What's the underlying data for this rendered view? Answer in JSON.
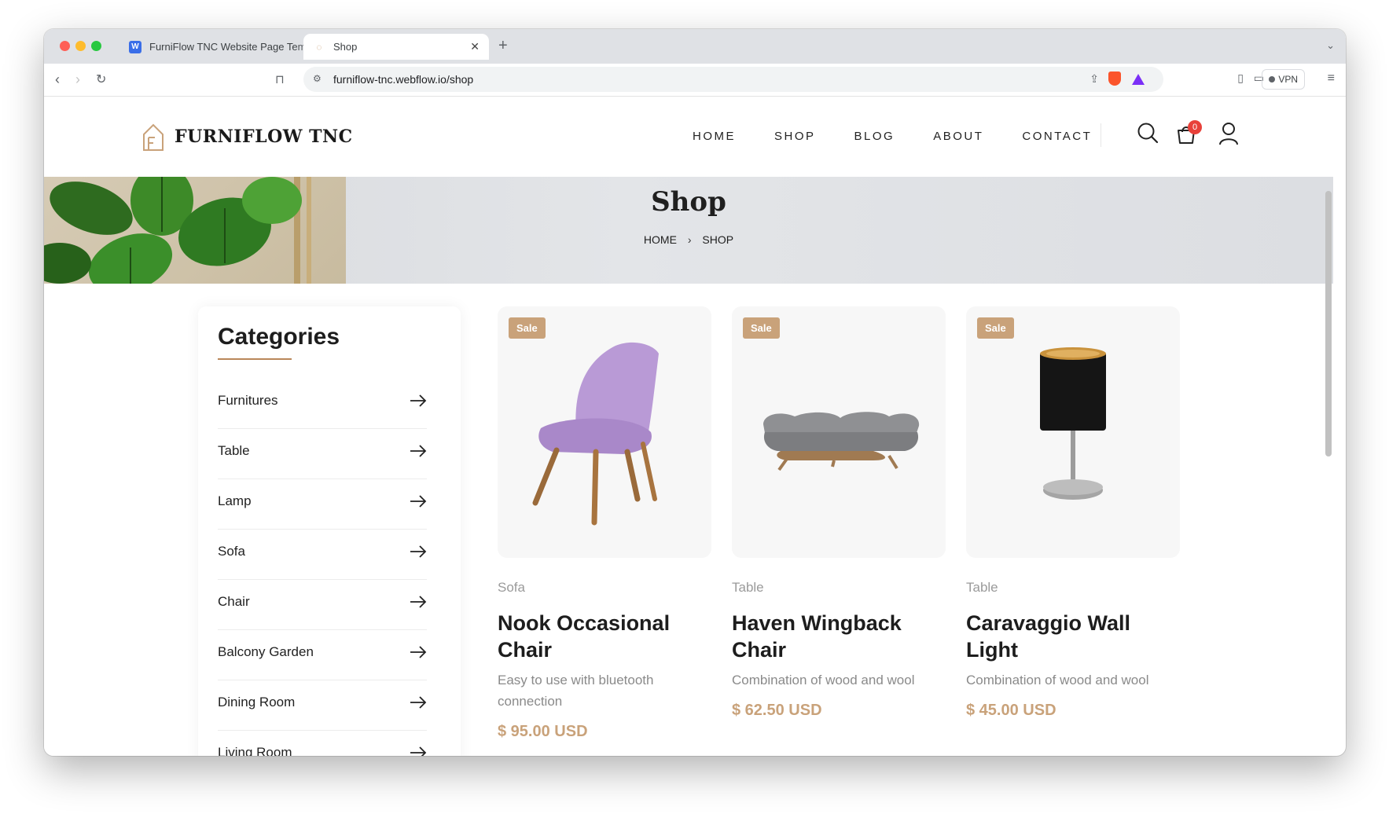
{
  "browser": {
    "tabs": [
      {
        "title": "FurniFlow TNC Website Page Tem",
        "favicon": "W",
        "active": false
      },
      {
        "title": "Shop",
        "active": true
      }
    ],
    "url": "furniflow-tnc.webflow.io/shop",
    "vpn_label": "VPN"
  },
  "site": {
    "logo_text": "FURNIFLOW TNC",
    "nav": [
      "HOME",
      "SHOP",
      "BLOG",
      "ABOUT",
      "CONTACT"
    ],
    "cart_count": "0"
  },
  "banner": {
    "title": "Shop",
    "breadcrumb": [
      "HOME",
      "SHOP"
    ]
  },
  "sidebar": {
    "title": "Categories",
    "items": [
      "Furnitures",
      "Table",
      "Lamp",
      "Sofa",
      "Chair",
      "Balcony Garden",
      "Dining Room",
      "Living Room"
    ]
  },
  "products": [
    {
      "badge": "Sale",
      "category": "Sofa",
      "name": "Nook Occasional Chair",
      "description": "Easy to use with bluetooth connection",
      "price": "$ 95.00 USD"
    },
    {
      "badge": "Sale",
      "category": "Table",
      "name": "Haven Wingback Chair",
      "description": "Combination of wood and wool",
      "price": "$ 62.50 USD"
    },
    {
      "badge": "Sale",
      "category": "Table",
      "name": "Caravaggio Wall Light",
      "description": "Combination of wood and wool",
      "price": "$ 45.00 USD"
    }
  ],
  "colors": {
    "accent": "#c9a27a",
    "badge_red": "#e8413a"
  }
}
